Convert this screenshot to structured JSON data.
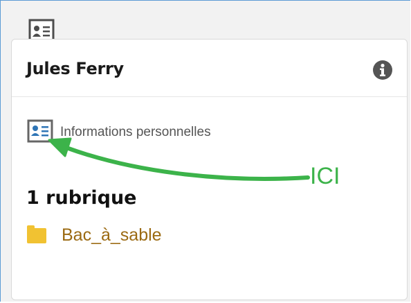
{
  "header": {
    "top_icon": "contact-card-icon"
  },
  "card": {
    "title": "Jules Ferry",
    "info_icon": "info-icon",
    "profile_link": {
      "icon": "contact-card-icon",
      "label": "Informations personnelles"
    },
    "annotation": {
      "text": "ICI",
      "color": "#3cb34a"
    },
    "section_title": "1 rubrique",
    "rubrics": [
      {
        "icon": "folder-icon",
        "label": "Bac_à_sable"
      }
    ]
  },
  "colors": {
    "frame_border": "#5b9bd5",
    "rubric_link": "#9b6a12",
    "folder": "#f1c232",
    "icon_blue": "#2e75b6"
  }
}
